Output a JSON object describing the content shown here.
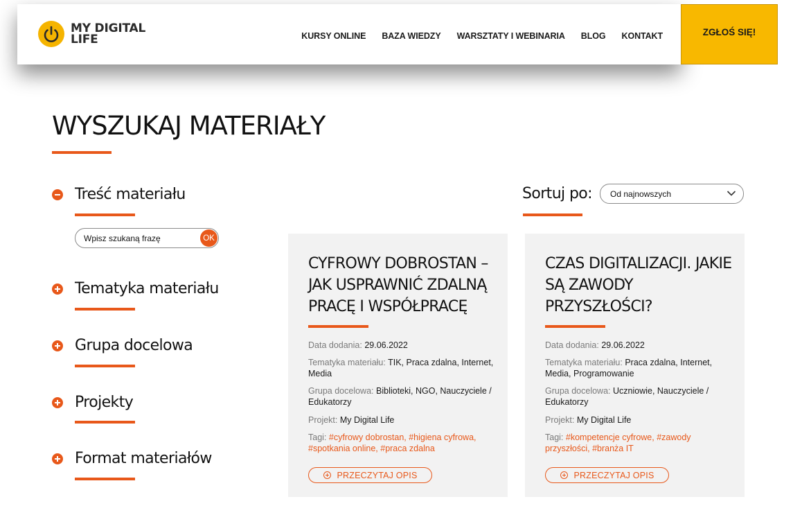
{
  "header": {
    "logo_line1": "MY DIGITAL",
    "logo_line2": "LIFE",
    "nav": [
      "KURSY ONLINE",
      "BAZA WIEDZY",
      "WARSZTATY I WEBINARIA",
      "BLOG",
      "KONTAKT"
    ],
    "cta_label": "ZGŁOŚ SIĘ!"
  },
  "colors": {
    "accent": "#e8581a",
    "brand_yellow": "#f8b800",
    "card_bg": "#f2f2f2"
  },
  "page_title": "WYSZUKAJ MATERIAŁY",
  "filters": {
    "content": {
      "label": "Treść materiału",
      "expanded": true
    },
    "search": {
      "placeholder": "Wpisz szukaną frazę",
      "value": "",
      "button_label": "OK"
    },
    "others": [
      {
        "label": "Tematyka materiału",
        "expanded": false
      },
      {
        "label": "Grupa docelowa",
        "expanded": false
      },
      {
        "label": "Projekty",
        "expanded": false
      },
      {
        "label": "Format materiałów",
        "expanded": false
      }
    ]
  },
  "sort": {
    "label": "Sortuj po:",
    "selected": "Od najnowszych"
  },
  "cards": [
    {
      "title": "CYFROWY DOBROSTAN – JAK USPRAWNIĆ ZDALNĄ PRACĘ I WSPÓŁPRACĘ",
      "date_key": "Data dodania:",
      "date": "29.06.2022",
      "topic_key": "Tematyka materiału:",
      "topic": "TIK, Praca zdalna, Internet, Media",
      "group_key": "Grupa docelowa:",
      "group": "Biblioteki, NGO, Nauczyciele / Edukatorzy",
      "project_key": "Projekt:",
      "project": "My Digital Life",
      "tags_key": "Tagi:",
      "tags": "#cyfrowy dobrostan, #higiena cyfrowa, #spotkania online, #praca zdalna",
      "button": "PRZECZYTAJ OPIS"
    },
    {
      "title": "CZAS DIGITALIZACJI. JAKIE SĄ ZAWODY PRZYSZŁOŚCI?",
      "date_key": "Data dodania:",
      "date": "29.06.2022",
      "topic_key": "Tematyka materiału:",
      "topic": "Praca zdalna, Internet, Media, Programowanie",
      "group_key": "Grupa docelowa:",
      "group": "Uczniowie, Nauczyciele / Edukatorzy",
      "project_key": "Projekt:",
      "project": "My Digital Life",
      "tags_key": "Tagi:",
      "tags": "#kompetencje cyfrowe, #zawody przyszłości, #branża IT",
      "button": "PRZECZYTAJ OPIS"
    }
  ]
}
